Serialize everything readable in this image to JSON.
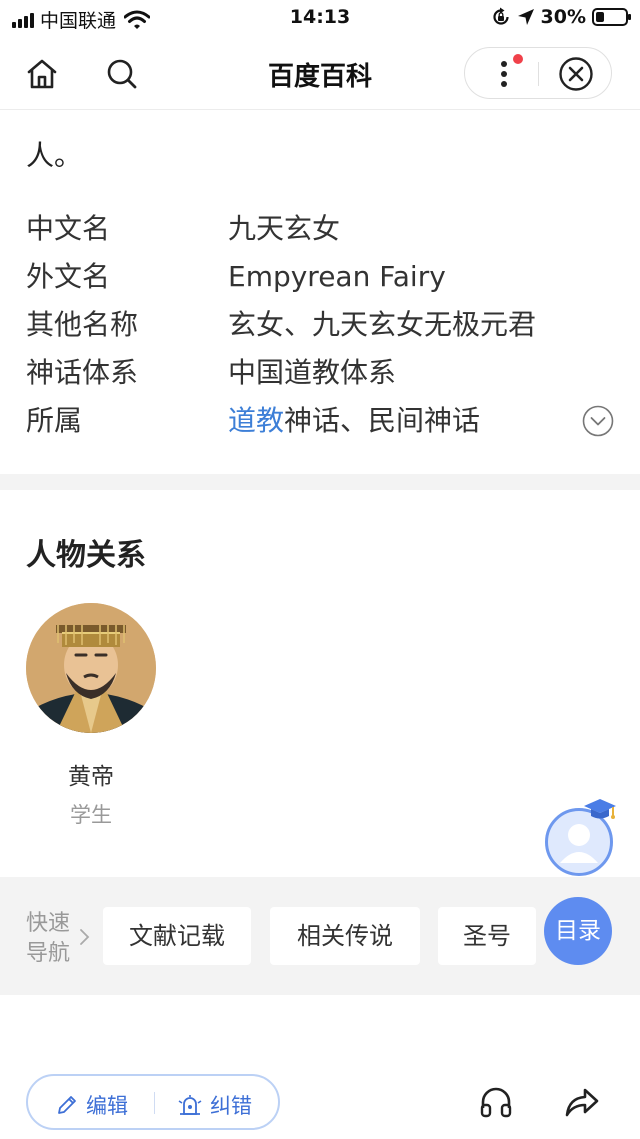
{
  "status_bar": {
    "carrier": "中国联通",
    "time": "14:13",
    "battery": "30%",
    "battery_level": 0.3,
    "icons": [
      "signal-icon",
      "wifi-icon",
      "rotation-lock-icon",
      "location-arrow-icon",
      "battery-icon"
    ]
  },
  "nav": {
    "title": "百度百科",
    "icons": [
      "home-icon",
      "search-icon",
      "more-icon",
      "close-icon"
    ],
    "notification_dot_color": "#f0414a"
  },
  "intro": {
    "tail": "人。"
  },
  "info": [
    {
      "key": "中文名",
      "value": "九天玄女"
    },
    {
      "key": "外文名",
      "value": "Empyrean Fairy"
    },
    {
      "key": "其他名称",
      "value": "玄女、九天玄女无极元君"
    },
    {
      "key": "神话体系",
      "value": "中国道教体系"
    },
    {
      "key": "所属",
      "link": "道教",
      "value": "神话、民间神话"
    }
  ],
  "relations": {
    "title": "人物关系",
    "people": [
      {
        "name": "黄帝",
        "relation": "学生"
      }
    ]
  },
  "quick_nav": {
    "label_line1": "快速",
    "label_line2": "导航",
    "items": [
      "文献记载",
      "相关传说",
      "圣号"
    ],
    "toc": "目录"
  },
  "bottom_bar": {
    "edit": "编辑",
    "correct": "纠错",
    "icons": [
      "pencil-icon",
      "bug-icon",
      "headphones-icon",
      "share-icon"
    ]
  },
  "colors": {
    "link": "#3d7fd7",
    "accent": "#5e8cf0",
    "separator": "#f3f3f3"
  }
}
